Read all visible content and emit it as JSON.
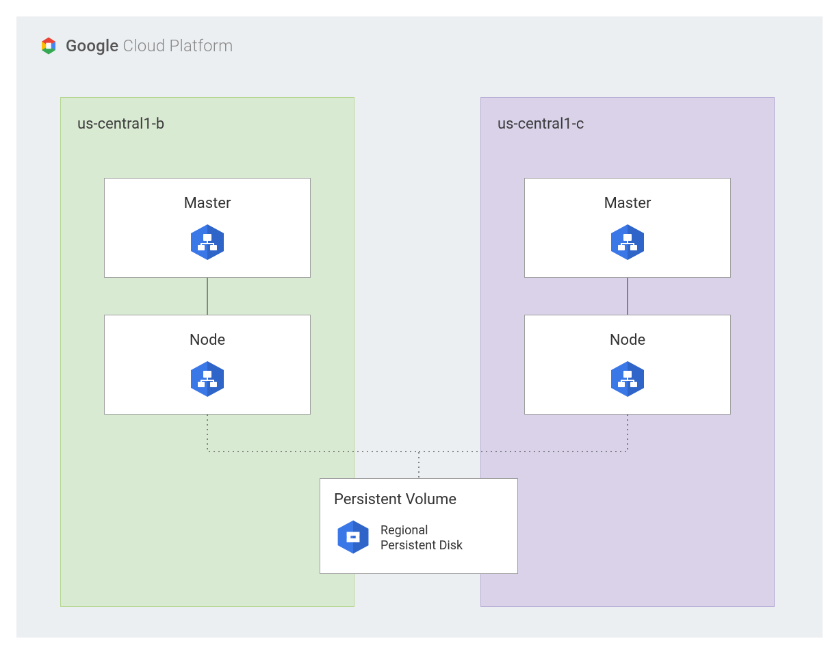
{
  "header": {
    "brand_bold": "Google",
    "brand_light": " Cloud Platform"
  },
  "zones": {
    "left": {
      "title": "us-central1-b",
      "master_label": "Master",
      "node_label": "Node"
    },
    "right": {
      "title": "us-central1-c",
      "master_label": "Master",
      "node_label": "Node"
    }
  },
  "persistent_volume": {
    "title": "Persistent Volume",
    "sub_line1": "Regional",
    "sub_line2": "Persistent Disk"
  },
  "colors": {
    "gcp_blue": "#3b78e7",
    "zone_green": "#d9ead3",
    "zone_purple": "#d9d2e9",
    "canvas_bg": "#eceff1"
  }
}
